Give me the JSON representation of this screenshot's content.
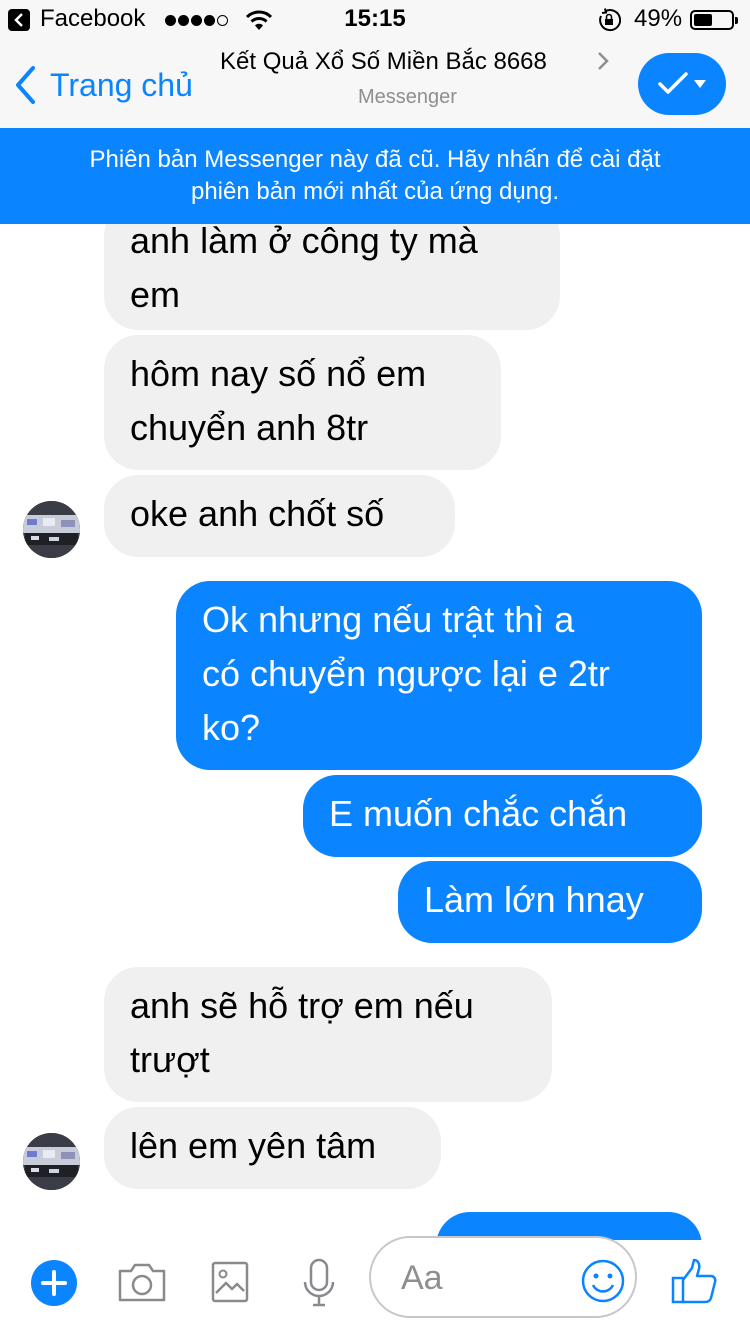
{
  "status_bar": {
    "app_name": "Facebook",
    "time": "15:15",
    "battery_text": "49%",
    "battery_level": 0.49,
    "signal_bars_filled": 4,
    "signal_bars_total": 5
  },
  "nav": {
    "back_label": "Trang chủ",
    "title": "Kết Quả Xổ Số Miền Bắc 8668",
    "subtitle": "Messenger",
    "action_icon": "checkmark-dropdown-icon"
  },
  "banner": {
    "line1": "Phiên bản Messenger này đã cũ. Hãy nhấn để cài đặt",
    "line2": "phiên bản mới nhất của ứng dụng."
  },
  "messages": [
    {
      "side": "received",
      "lines": [
        "anh làm ở công ty mà",
        "em"
      ]
    },
    {
      "side": "received",
      "lines": [
        "hôm nay số nổ em",
        "chuyển anh 8tr"
      ]
    },
    {
      "side": "received",
      "lines": [
        "oke anh chốt số"
      ],
      "avatar": true
    },
    {
      "side": "sent",
      "lines": [
        "Ok nhưng nếu trật thì a",
        "có chuyển ngược lại e 2tr",
        "ko?"
      ]
    },
    {
      "side": "sent",
      "lines": [
        "E muốn chắc chắn"
      ]
    },
    {
      "side": "sent",
      "lines": [
        "Làm lớn hnay"
      ]
    },
    {
      "side": "received",
      "lines": [
        "anh sẽ hỗ trợ em nếu",
        "trượt"
      ]
    },
    {
      "side": "received",
      "lines": [
        "lên em yên tâm"
      ],
      "avatar": true
    }
  ],
  "composer": {
    "placeholder": "Aa",
    "icons": [
      "plus-icon",
      "camera-icon",
      "image-icon",
      "microphone-icon",
      "emoji-icon",
      "thumbs-up-icon"
    ]
  },
  "colors": {
    "accent": "#0a84ff",
    "received_bubble": "#f0f0f0",
    "bar_background": "#f7f7f7"
  }
}
